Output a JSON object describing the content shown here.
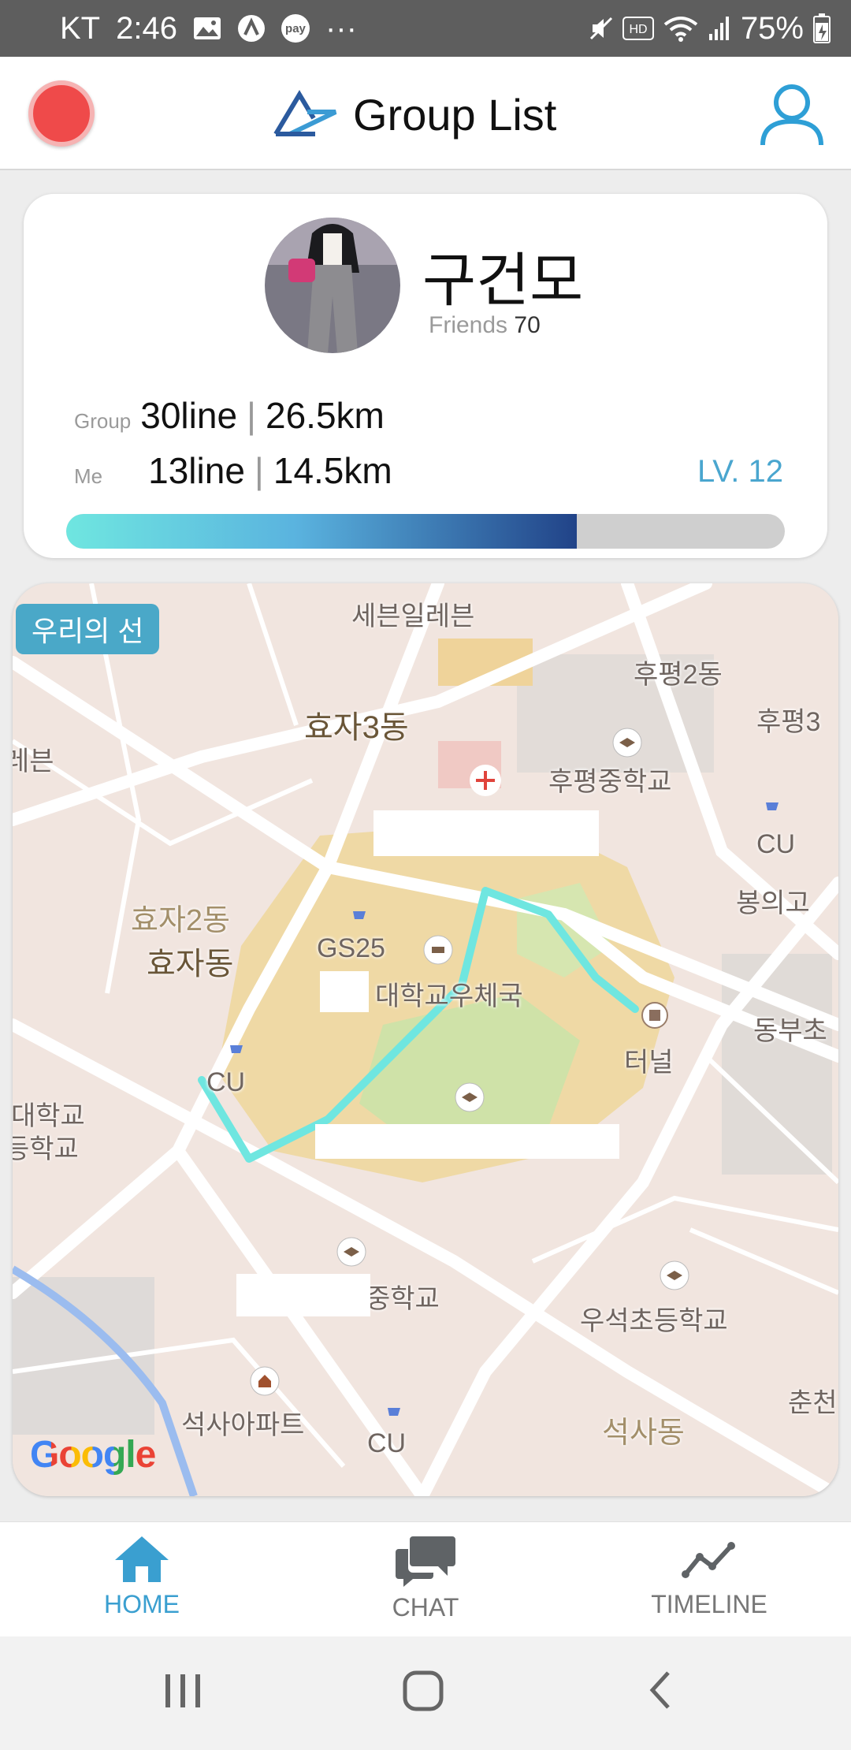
{
  "status_bar": {
    "carrier": "KT",
    "time": "2:46",
    "battery": "75%",
    "notification_icons": [
      "image-icon",
      "a-icon",
      "pay-icon"
    ],
    "more": "···",
    "pay_badge": "pay"
  },
  "header": {
    "title": "Group List"
  },
  "profile": {
    "name": "구건모",
    "friends_label": "Friends",
    "friends_count": "70",
    "group_label": "Group",
    "group_lines": "30line",
    "group_distance": "26.5km",
    "me_label": "Me",
    "me_lines": "13line",
    "me_distance": "14.5km",
    "level": "LV. 12",
    "progress_fraction": 0.71,
    "colors": {
      "accent": "#4aa6cf",
      "progress_start": "#6fe6e0",
      "progress_end": "#214388"
    }
  },
  "map": {
    "badge": "우리의 선",
    "route_color": "#6fe6e0",
    "labels": [
      "세븐일레븐",
      "후평2동",
      "효자3동",
      "후평3",
      "레븐",
      "후평중학교",
      "CU",
      "봉의고",
      "효자2동",
      "효자동",
      "GS25",
      "대학교우체국",
      "동부초",
      "터널",
      "CU",
      "대학교",
      "등학교",
      "중학교",
      "우석초등학교",
      "춘천",
      "석사아파트",
      "CU",
      "석사동"
    ],
    "attribution": "Google"
  },
  "bottom_nav": {
    "items": [
      {
        "label": "HOME",
        "icon": "home-icon"
      },
      {
        "label": "CHAT",
        "icon": "chat-icon"
      },
      {
        "label": "TIMELINE",
        "icon": "timeline-icon"
      }
    ]
  },
  "system_nav": {
    "buttons": [
      "recents-icon",
      "home-circle-icon",
      "back-icon"
    ]
  }
}
